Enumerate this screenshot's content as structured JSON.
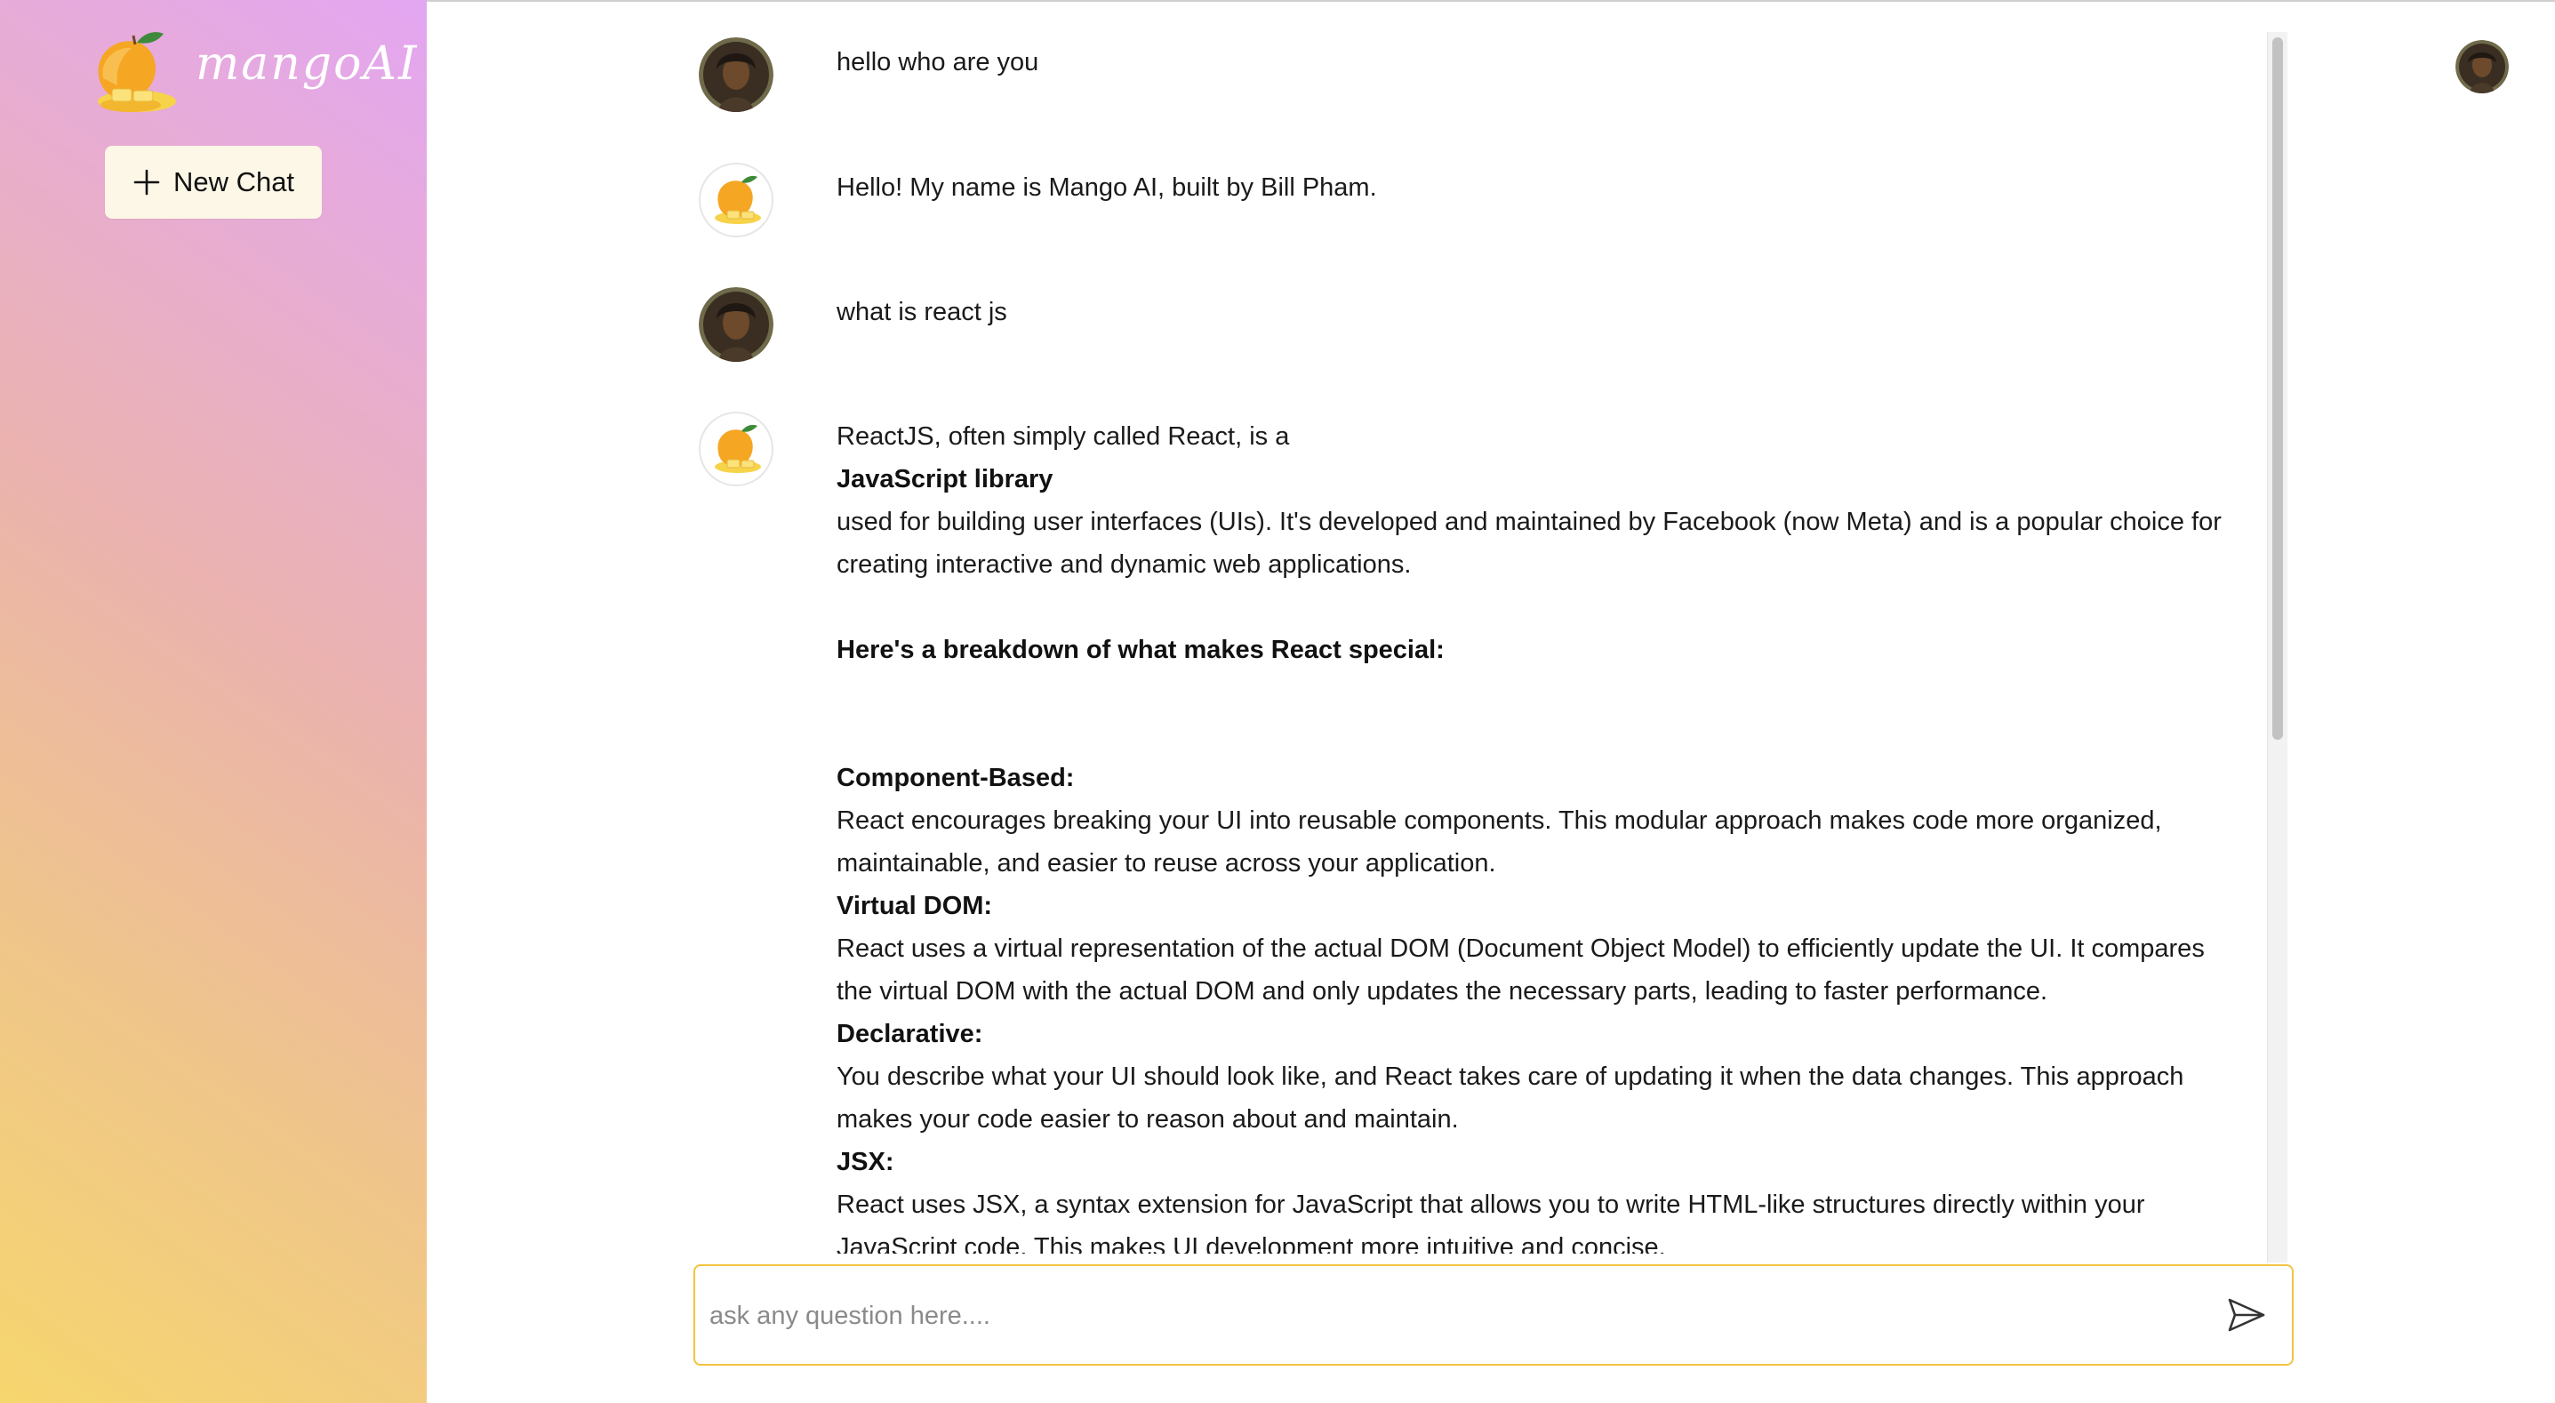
{
  "sidebar": {
    "brand": "mangoAI",
    "new_chat_label": "New Chat"
  },
  "colors": {
    "sidebar_gradient": [
      "#f6d66e",
      "#ebb3ad",
      "#e3a6f2"
    ],
    "input_border": "#f2c440"
  },
  "icons": {
    "logo": "mango-logo-icon",
    "new_chat": "plus-icon",
    "send": "send-icon",
    "user_avatar": "user-avatar",
    "bot_avatar": "mango-avatar"
  },
  "messages": [
    {
      "role": "user",
      "text": "hello who are you"
    },
    {
      "role": "assistant",
      "text": "Hello! My name is Mango AI, built by Bill Pham."
    },
    {
      "role": "user",
      "text": "what is react js"
    },
    {
      "role": "assistant",
      "intro_1": "ReactJS, often simply called React, is a",
      "intro_bold": "JavaScript library",
      "intro_2": "used for building user interfaces (UIs). It's developed and maintained by Facebook (now Meta) and is a popular choice for creating interactive and dynamic web applications.",
      "breakdown_heading": "Here's a breakdown of what makes React special:",
      "features": [
        {
          "title": "Component-Based:",
          "body": "React encourages breaking your UI into reusable components. This modular approach makes code more organized, maintainable, and easier to reuse across your application."
        },
        {
          "title": "Virtual DOM:",
          "body": "React uses a virtual representation of the actual DOM (Document Object Model) to efficiently update the UI. It compares the virtual DOM with the actual DOM and only updates the necessary parts, leading to faster performance."
        },
        {
          "title": "Declarative:",
          "body": "You describe what your UI should look like, and React takes care of updating it when the data changes. This approach makes your code easier to reason about and maintain."
        },
        {
          "title": "JSX:",
          "body": "React uses JSX, a syntax extension for JavaScript that allows you to write HTML-like structures directly within your JavaScript code. This makes UI development more intuitive and concise."
        }
      ]
    }
  ],
  "input": {
    "placeholder": "ask any question here....",
    "value": ""
  }
}
